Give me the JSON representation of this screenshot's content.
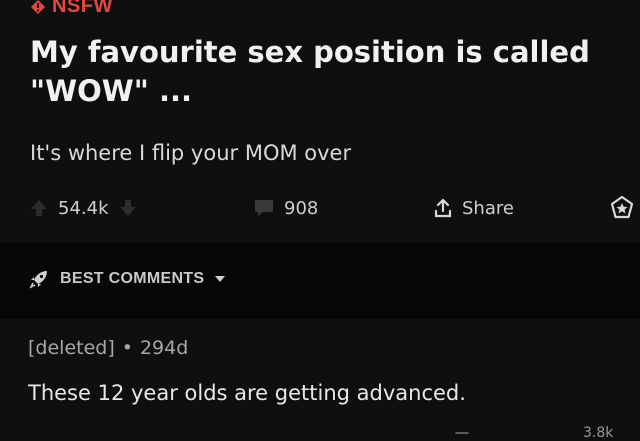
{
  "post": {
    "nsfw_label": "NSFW",
    "title": "My favourite sex position is called \"WOW\" ...",
    "body": "It's where I flip your MOM over"
  },
  "actions": {
    "votes": "54.4k",
    "comments": "908",
    "share_label": "Share"
  },
  "sort": {
    "label": "BEST COMMENTS"
  },
  "comment": {
    "author": "[deleted]",
    "separator": "•",
    "age": "294d",
    "text": "These 12 year olds are getting advanced.",
    "next_votes_partial": "3.8k"
  },
  "colors": {
    "background": "#0f0f0f",
    "nsfw_accent": "#e5483f",
    "text": "#e6e6e6",
    "muted": "#a7a7a7"
  }
}
